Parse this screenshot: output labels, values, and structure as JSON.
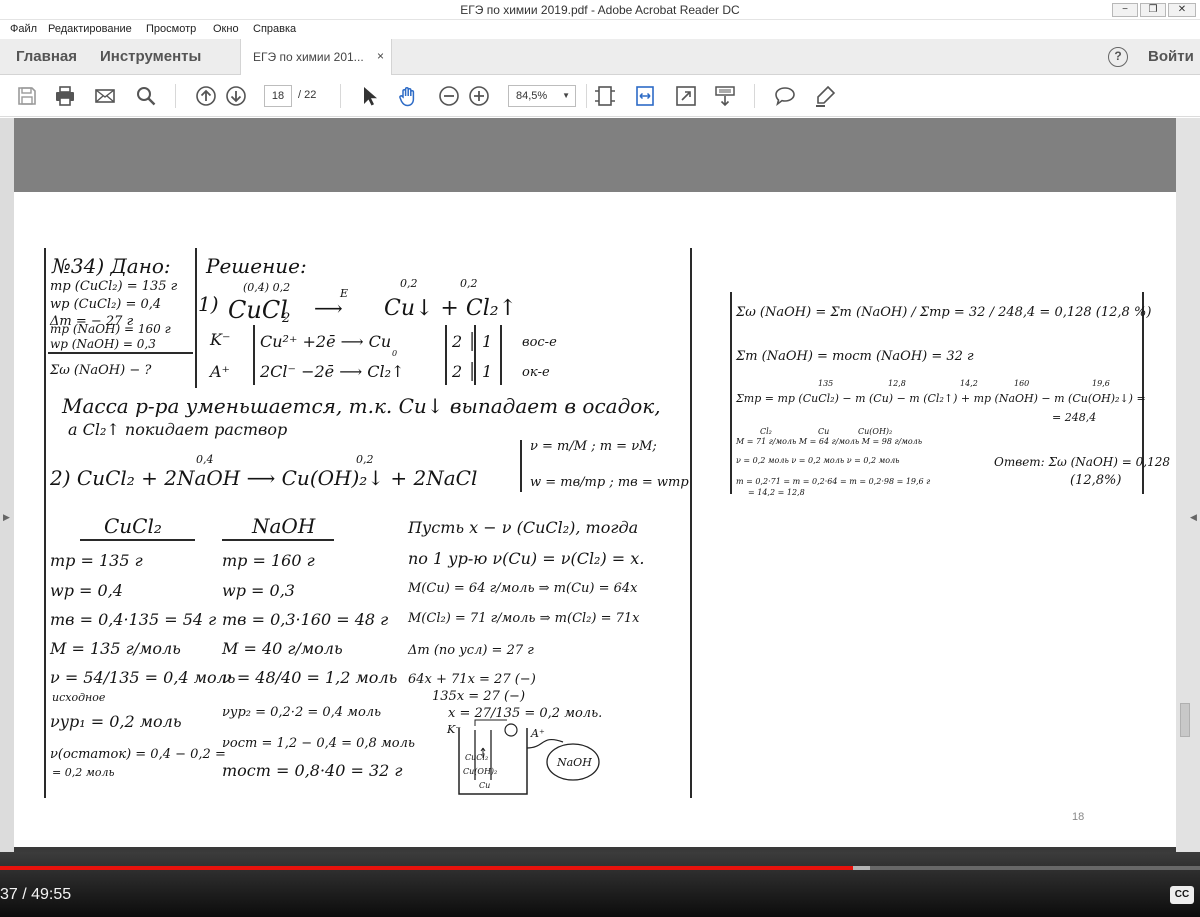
{
  "window": {
    "title": "ЕГЭ по химии 2019.pdf - Adobe Acrobat Reader DC",
    "controls": [
      "−",
      "❐",
      "✕"
    ]
  },
  "menu": [
    "Файл",
    "Редактирование",
    "Просмотр",
    "Окно",
    "Справка"
  ],
  "tabs": {
    "home": "Главная",
    "tools": "Инструменты",
    "document": "ЕГЭ по химии 201...",
    "close": "×",
    "help": "?",
    "login": "Войти"
  },
  "toolbar": {
    "page_current": "18",
    "page_total": "/ 22",
    "zoom": "84,5%",
    "zoom_arrow": "▼",
    "icons": [
      "save-icon",
      "print-icon",
      "email-icon",
      "search-icon",
      "page-up-icon",
      "page-down-icon",
      "select-arrow-icon",
      "hand-tool-icon",
      "zoom-out-icon",
      "zoom-in-icon",
      "fit-page-icon",
      "fit-width-icon",
      "full-screen-icon",
      "scroll-mode-icon",
      "comment-icon",
      "highlight-pen-icon"
    ]
  },
  "document": {
    "page_number_label": "18",
    "left": {
      "given": [
        "№34) Дано:",
        "mр (CuCl₂) = 135 г",
        "wр (CuCl₂) = 0,4",
        "Δm = − 27 г",
        "mр (NaOH) = 160 г",
        "wр (NaOH) = 0,3",
        "Σω (NaOH) − ?"
      ],
      "solution_title": "Решение:",
      "eq1": {
        "num": "1)",
        "reactant": "CuCl",
        "reactant_sub": "2",
        "coef_above": "(0,4)  0,2",
        "arrow": "⟶",
        "over_arrow": "E",
        "products": "Cu↓ + Cl₂↑",
        "prod_coef_1": "0,2",
        "prod_coef_2": "0,2"
      },
      "electrolysis": {
        "k": "K⁻",
        "a": "A⁺",
        "row1": "Cu²⁺  +2ē ⟶ Cu",
        "row1_factors": "2 │ 1",
        "row1_note": "вос-е",
        "row2": "2Cl⁻  −2ē ⟶ Cl₂↑",
        "row2_factors": "2 │ 1",
        "row2_note": "ок-е",
        "zero": "0"
      },
      "note_line1": "Масса р-ра уменьшается, т.к. Cu↓ выпадает в осадок,",
      "note_line2": "а Cl₂↑ покидает раствор",
      "eq2": {
        "line": "2) CuCl₂ + 2NaOH ⟶ Cu(OH)₂↓ + 2NaCl",
        "c1": "0,2",
        "c2": "0,4",
        "c3": "0,2"
      },
      "formulas": {
        "f1": "ν = m/M ; m = νM;",
        "f2": "w = mв/mр ; mв = wmр"
      },
      "col_cucl2": [
        "CuCl₂",
        "mр = 135 г",
        "wр = 0,4",
        "mв = 0,4·135 = 54 г",
        "M = 135 г/моль",
        "ν = 54/135 = 0,4 моль",
        "исходное",
        "νур₁ = 0,2 моль",
        "ν(остаток) = 0,4 − 0,2 =",
        "= 0,2 моль"
      ],
      "col_naoh": [
        "NaOH",
        "mр = 160 г",
        "wр = 0,3",
        "mв = 0,3·160 = 48 г",
        "M = 40 г/моль",
        "ν = 48/40 = 1,2 моль",
        "νур₂ = 0,2·2 = 0,4 моль",
        "νост = 1,2 − 0,4 = 0,8 моль",
        "mост = 0,8·40 = 32 г"
      ],
      "col_calc": [
        "Пусть x − ν (CuCl₂), тогда",
        "по 1 ур-ю ν(Cu) = ν(Cl₂) = x.",
        "M(Cu) = 64 г/моль ⇒ m(Cu) = 64x",
        "M(Cl₂) = 71 г/моль ⇒ m(Cl₂) = 71x",
        "Δm (по усл) = 27 г",
        "64x + 71x = 27 (−)",
        "135x = 27 (−)",
        "x = 27/135 = 0,2 моль."
      ],
      "diagram": {
        "k": "K⁻",
        "a": "A⁺",
        "cucl2": "CuCl₂",
        "cuoh2": "Cu(OH)₂",
        "cu": "Cu",
        "naoh": "NaOH"
      }
    },
    "right": {
      "r1": "Σω (NaOH) = Σm (NaOH) / Σmр = 32 / 248,4 = 0,128  (12,8 %)",
      "r2": "Σm (NaOH) = mост (NaOH) = 32 г",
      "r3": "Σmр = mр (CuCl₂) − m (Cu) − m (Cl₂↑) + mр (NaOH) − m (Cu(OH)₂↓) =",
      "r3_over": [
        "135",
        "12,8",
        "14,2",
        "160",
        "19,6"
      ],
      "r3_result": "= 248,4",
      "molar_labels": [
        "Cl₂",
        "Cu",
        "Cu(OH)₂"
      ],
      "molar": "M = 71 г/моль   M = 64 г/моль   M = 98 г/моль",
      "moles": "ν = 0,2 моль     ν = 0,2 моль     ν = 0,2 моль",
      "masses_top": "m = 0,2·71 =     m = 0,2·64 =     m = 0,2·98 = 19,6 г",
      "masses_bottom": "= 14,2              = 12,8",
      "answer": "Ответ: Σω (NaOH) = 0,128",
      "answer_pct": "(12,8%)"
    }
  },
  "video": {
    "time": "37 / 49:55",
    "progress": 0.711,
    "buffered": 0.725,
    "cc": "CC"
  },
  "colors": {
    "progress": "#e8120c",
    "reader_gray": "#808080",
    "toolbar_icon": "#5a5a5a",
    "accent_blue": "#2d6bc6"
  }
}
